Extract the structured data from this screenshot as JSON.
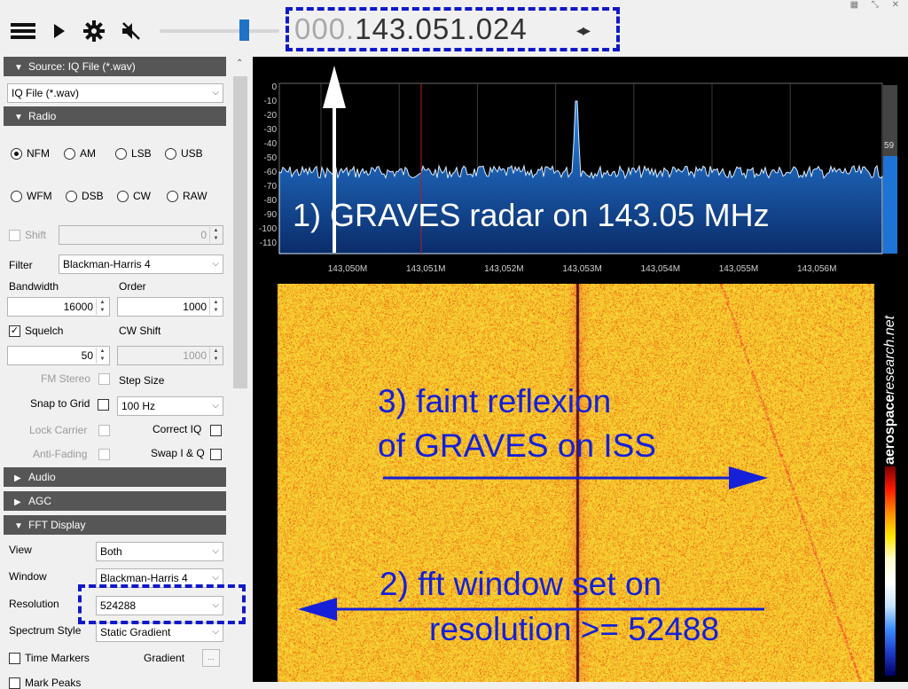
{
  "toolbar": {
    "frequency_dim": "000.",
    "frequency_main": "143.051.024",
    "frequency_arrows": "◂▸",
    "window_controls": "▦ ⤡ ✕",
    "icons": [
      "menu-icon",
      "play-icon",
      "gear-icon",
      "speaker-mute-icon"
    ]
  },
  "panel": {
    "source_header": "Source: IQ File (*.wav)",
    "source_select": "IQ File (*.wav)",
    "radio_header": "Radio",
    "modes_row1": [
      "NFM",
      "AM",
      "LSB",
      "USB"
    ],
    "modes_row2": [
      "WFM",
      "DSB",
      "CW",
      "RAW"
    ],
    "selected_mode": "NFM",
    "shift_label": "Shift",
    "shift_value": "0",
    "filter_label": "Filter",
    "filter_value": "Blackman-Harris 4",
    "bandwidth_label": "Bandwidth",
    "bandwidth_value": "16000",
    "order_label": "Order",
    "order_value": "1000",
    "squelch_label": "Squelch",
    "squelch_checked": true,
    "squelch_value": "50",
    "cw_shift_label": "CW Shift",
    "cw_shift_value": "1000",
    "fm_stereo_label": "FM Stereo",
    "step_size_label": "Step Size",
    "snap_label": "Snap to Grid",
    "step_size_value": "100 Hz",
    "lock_carrier_label": "Lock Carrier",
    "correct_iq_label": "Correct IQ",
    "anti_fading_label": "Anti-Fading",
    "swap_iq_label": "Swap I & Q",
    "audio_header": "Audio",
    "agc_header": "AGC",
    "fft_header": "FFT Display",
    "view_label": "View",
    "view_value": "Both",
    "window_label": "Window",
    "window_value": "Blackman-Harris 4",
    "resolution_label": "Resolution",
    "resolution_value": "524288",
    "spectrum_style_label": "Spectrum Style",
    "spectrum_style_value": "Static Gradient",
    "time_markers_label": "Time Markers",
    "gradient_label": "Gradient",
    "gradient_button": "...",
    "mark_peaks_label": "Mark Peaks"
  },
  "spectrum": {
    "y_ticks": [
      "0",
      "-10",
      "-20",
      "-30",
      "-40",
      "-50",
      "-60",
      "-70",
      "-80",
      "-90",
      "-100",
      "-110"
    ],
    "x_ticks": [
      "143,050M",
      "143,051M",
      "143,052M",
      "143,053M",
      "143,054M",
      "143,055M",
      "143,056M"
    ],
    "meter_value": "59",
    "annotation": "1) GRAVES radar on 143.05 MHz"
  },
  "waterfall": {
    "annotation3_line1": "3) faint reflexion",
    "annotation3_line2": "of GRAVES on ISS",
    "annotation2_line1": "2) fft window set on",
    "annotation2_line2": "resolution >= 52488",
    "watermark_bold": "aerospace",
    "watermark_italic": "research.net"
  },
  "colors": {
    "annotation_blue": "#1520d8",
    "spectrum_fill": "#1e6ad0",
    "waterfall_base": "#f59a1c",
    "section_header": "#565656"
  }
}
